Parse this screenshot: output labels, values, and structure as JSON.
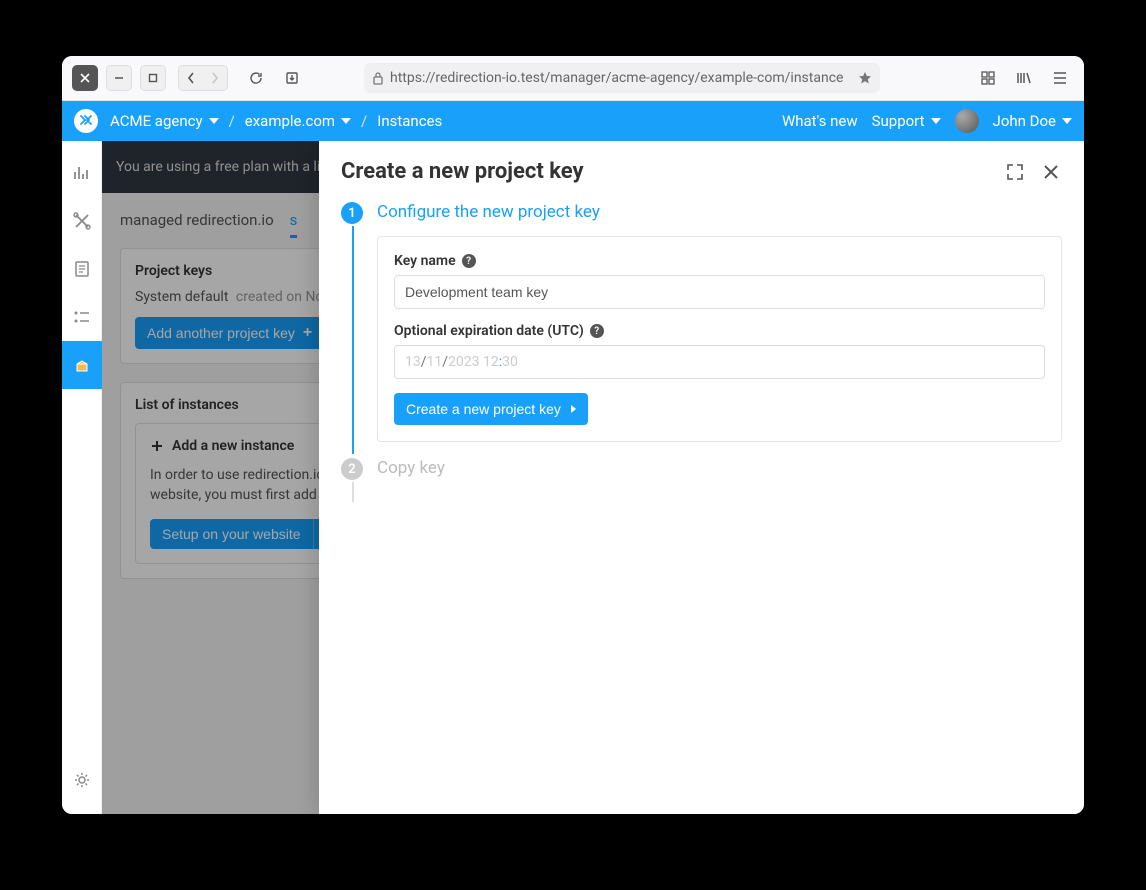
{
  "browser": {
    "url": "https://redirection-io.test/manager/acme-agency/example-com/instance"
  },
  "header": {
    "org": "ACME agency",
    "project": "example.com",
    "page": "Instances",
    "whats_new": "What's new",
    "support": "Support",
    "user": "John Doe"
  },
  "banner": {
    "text": "You are using a free plan with a lim"
  },
  "tabs": {
    "managed": "managed redirection.io",
    "self": "s"
  },
  "project_keys": {
    "title": "Project keys",
    "system_default": "System default",
    "created_on": "created on Nove",
    "add_button": "Add another project key"
  },
  "instances": {
    "title": "List of instances",
    "add_new": "Add a new instance",
    "help": "In order to use redirection.io o",
    "help2": "website, you must first add an",
    "setup_btn": "Setup on your website"
  },
  "drawer": {
    "title": "Create a new project key",
    "step1": {
      "num": "1",
      "title": "Configure the new project key",
      "key_name_label": "Key name",
      "key_name_value": "Development team key",
      "exp_label": "Optional expiration date (UTC)",
      "date_dd": "13",
      "date_mm": "11",
      "date_yyyy": "2023",
      "date_hh": "12",
      "date_min": "30",
      "submit": "Create a new project key"
    },
    "step2": {
      "num": "2",
      "title": "Copy key"
    }
  }
}
